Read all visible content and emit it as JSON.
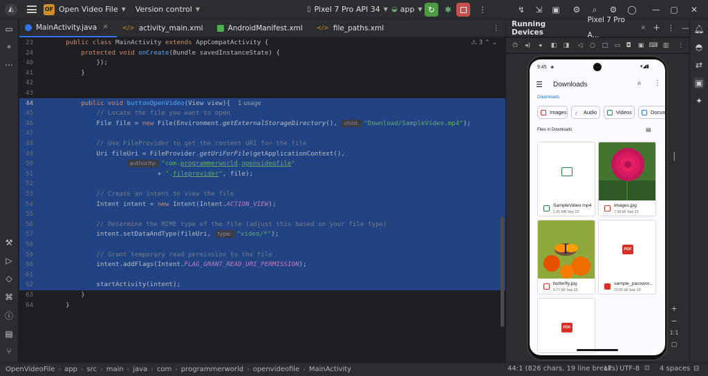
{
  "titlebar": {
    "project_badge": "OF",
    "project_name": "Open Video File",
    "vcs": "Version control",
    "device": "Pixel 7 Pro API 34",
    "run_config": "app"
  },
  "tabs": [
    {
      "label": "MainActivity.java",
      "color": "#3574f0"
    },
    {
      "label": "activity_main.xml",
      "color": "#d08e2b"
    },
    {
      "label": "AndroidManifest.xml",
      "color": "#4caf50"
    },
    {
      "label": "file_paths.xml",
      "color": "#d08e2b"
    }
  ],
  "editor": {
    "warnings": "3",
    "line_numbers": [
      "23",
      "24",
      "40",
      "41",
      "42",
      "43",
      "44",
      "45",
      "46",
      "47",
      "48",
      "49",
      "50",
      "51",
      "52",
      "53",
      "54",
      "55",
      "56",
      "57",
      "58",
      "59",
      "60",
      "61",
      "62",
      "63",
      "64"
    ],
    "hints": {
      "usage": "1 usage",
      "child": "child:",
      "authority": "authority:",
      "type": "type:"
    }
  },
  "running_devices": {
    "title": "Running Devices",
    "device_tab": "Pixel 7 Pro A..."
  },
  "phone": {
    "time": "9:45",
    "app_title": "Downloads",
    "breadcrumb": "Downloads",
    "chips": [
      {
        "label": "Images",
        "color": "#d93025"
      },
      {
        "label": "Audio",
        "color": "#a142f4"
      },
      {
        "label": "Videos",
        "color": "#1e8e3e"
      },
      {
        "label": "Docum",
        "color": "#1a73e8"
      }
    ],
    "section_label": "Files in Downloads",
    "files": [
      {
        "name": "SampleVideo.mp4",
        "meta": "1.06 MB Sep 23"
      },
      {
        "name": "images.jpg",
        "meta": "7.58 kB Sep 23"
      },
      {
        "name": "butterfly.jpg",
        "meta": "9.77 kB Sep 23"
      },
      {
        "name": "sample_passwor...",
        "meta": "23.05 kB Sep 19"
      }
    ],
    "pdf_label": "PDF"
  },
  "side_controls": {
    "zoom_in": "+",
    "zoom_out": "−",
    "ratio": "1:1"
  },
  "statusbar": {
    "breadcrumbs": [
      "OpenVideoFile",
      "app",
      "src",
      "main",
      "java",
      "com",
      "programmerworld",
      "openvideofile",
      "MainActivity"
    ],
    "position": "44:1 (826 chars, 19 line breaks)",
    "line_sep": "LF",
    "encoding": "UTF-8",
    "indent": "4 spaces"
  }
}
